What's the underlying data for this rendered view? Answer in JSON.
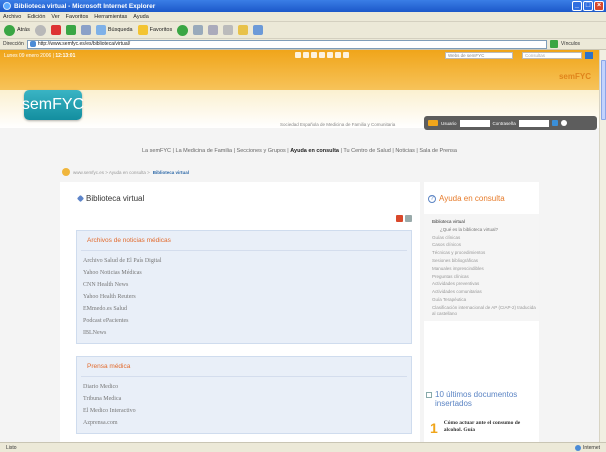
{
  "window": {
    "title": "Biblioteca virtual - Microsoft Internet Explorer",
    "buttons": [
      "_",
      "□",
      "×"
    ]
  },
  "menu": [
    "Archivo",
    "Edición",
    "Ver",
    "Favoritos",
    "Herramientas",
    "Ayuda"
  ],
  "toolbar": {
    "back": "Atrás",
    "search": "Búsqueda",
    "favorites": "Favoritos"
  },
  "address": {
    "label": "Dirección",
    "url": "http://www.semfyc.es/es/biblioteca/virtual/",
    "right": "Vínculos"
  },
  "top_strip": {
    "date": "Lunes 09 enero 2006",
    "time": "12:13:01",
    "select_placeholder": "Webs de semFYC",
    "search_placeholder": "Consultas",
    "brand": "semFYC"
  },
  "header": {
    "logo": "semFYC",
    "society": "Sociedad Española de Medicina de Familia y Comunitaria",
    "login_user": "Usuario",
    "login_pass": "Contraseña"
  },
  "nav": {
    "before": "La semFYC | La Medicina de Familia | Secciones y Grupos |",
    "active": "Ayuda en consulta",
    "after": "| Tu Centro de Salud | Noticias | Sala de Prensa"
  },
  "breadcrumb": {
    "prefix": "www.semfyc.es > Ayuda en consulta >",
    "current": "Biblioteca virtual"
  },
  "main": {
    "title": "Biblioteca virtual",
    "box1": {
      "heading": "Archivos de noticias médicas",
      "items": [
        "Archivo Salud de El País Digital",
        "Yahoo Noticias Médicas",
        "CNN Health News",
        "Yahoo Health Reuters",
        "EMmedo.es Salud",
        "Podcast ePacientes",
        "IBLNews"
      ]
    },
    "box2": {
      "heading": "Prensa médica",
      "items": [
        "Diario Medico",
        "Tribuna Medica",
        "El Medico Interactivo",
        "Azprensa.com"
      ]
    }
  },
  "sidebar": {
    "title": "Ayuda en consulta",
    "items": [
      {
        "label": "Biblioteca virtual",
        "type": "active"
      },
      {
        "label": "¿Qué es la biblioteca virtual?",
        "type": "sub"
      },
      {
        "label": "Guías clínicas",
        "type": "item"
      },
      {
        "label": "Casos clínicos",
        "type": "item"
      },
      {
        "label": "Técnicas y procedimientos",
        "type": "item"
      },
      {
        "label": "Sesiones bibliográficas",
        "type": "item"
      },
      {
        "label": "Manuales imprescindibles",
        "type": "item"
      },
      {
        "label": "Preguntas clínicas",
        "type": "item"
      },
      {
        "label": "Actividades preventivas",
        "type": "item"
      },
      {
        "label": "Actividades comunitarias",
        "type": "item"
      },
      {
        "label": "Guía Terapéutica",
        "type": "item"
      },
      {
        "label": "Clasificación internacional de AP (CIAP-2) traducida al castellano",
        "type": "item"
      }
    ],
    "docs_title": "10 últimos documentos insertados",
    "doc1": {
      "num": "1",
      "text": "Cómo actuar ante el consumo de alcohol. Guía"
    }
  },
  "status": {
    "left": "Listo",
    "zone": "Internet"
  },
  "colors": {
    "accent_orange": "#f0a51a",
    "title_blue": "#2f6aa8",
    "box_heading": "#e26a2c"
  }
}
